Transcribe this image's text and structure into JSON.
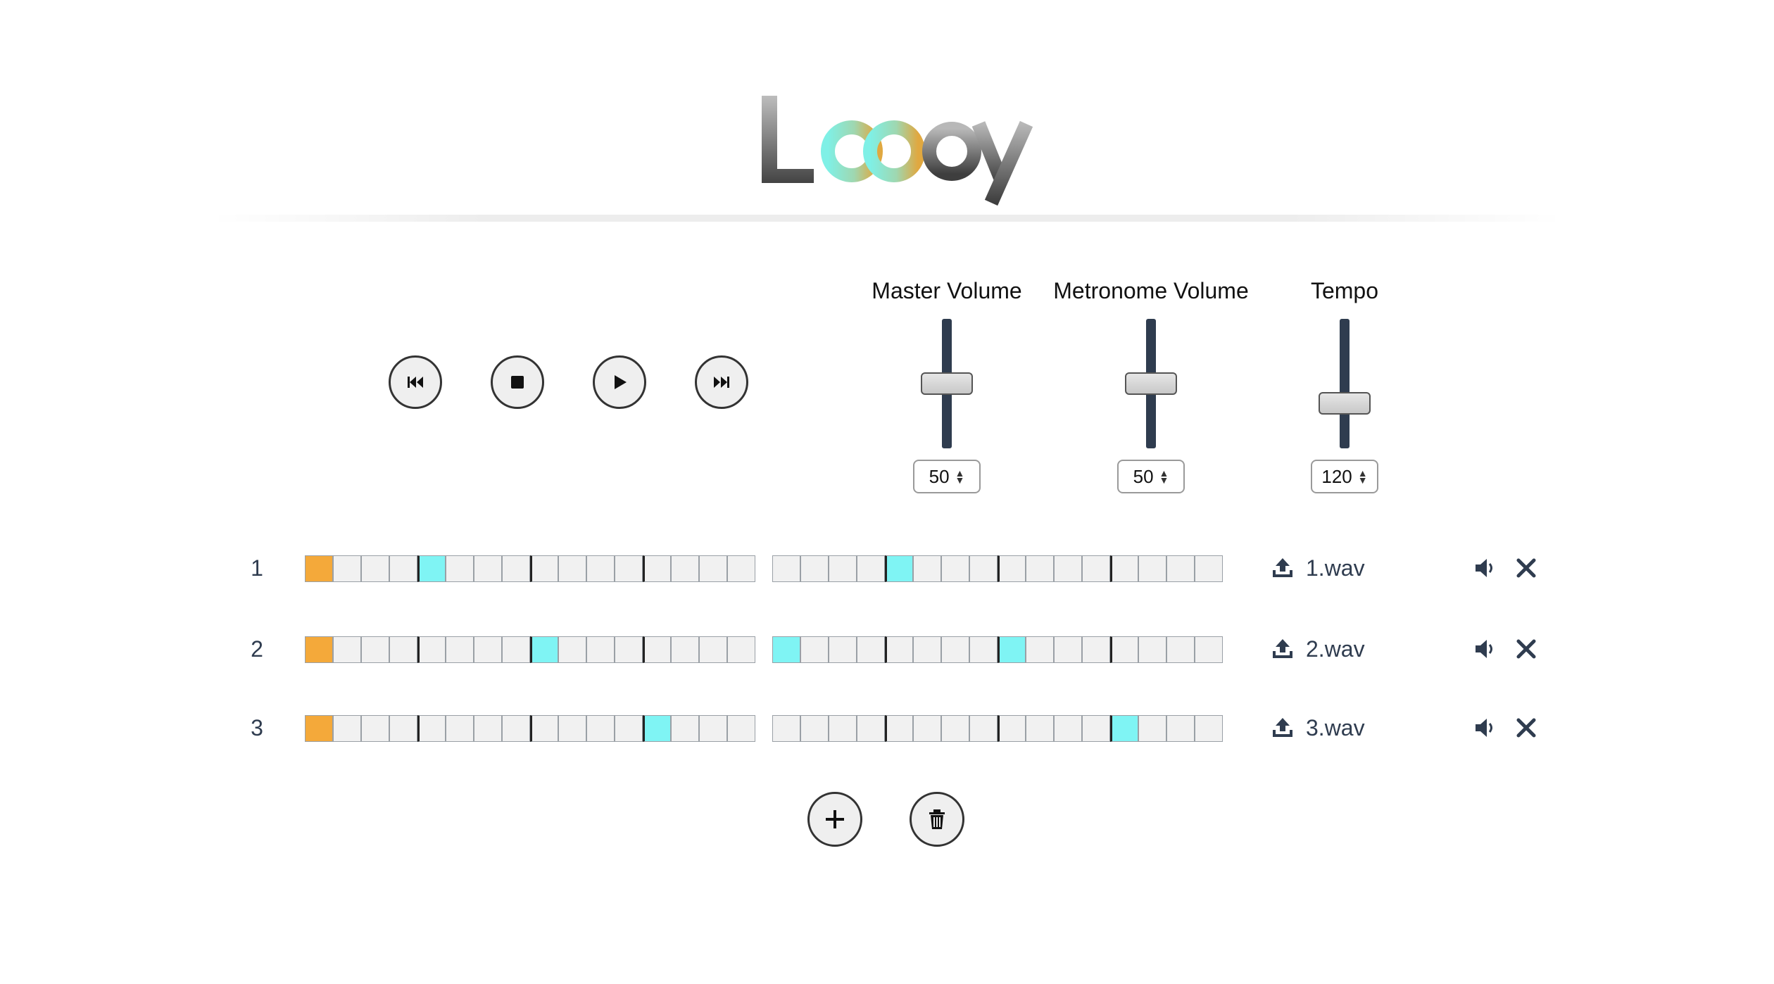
{
  "app": {
    "logo_text": "Loopy",
    "colors": {
      "track": "#2f3c4f",
      "current_step": "#f4a93a",
      "active_step": "#7ff4f4",
      "inactive_step": "#f1f1f1"
    }
  },
  "transport": {
    "buttons": [
      {
        "name": "skip-back",
        "icon": "skip-back-icon"
      },
      {
        "name": "stop",
        "icon": "stop-icon"
      },
      {
        "name": "play",
        "icon": "play-icon"
      },
      {
        "name": "skip-forward",
        "icon": "skip-forward-icon"
      }
    ]
  },
  "controls": {
    "master_volume": {
      "label": "Master Volume",
      "value": "50",
      "level": 0.5
    },
    "metronome_volume": {
      "label": "Metronome Volume",
      "value": "50",
      "level": 0.5
    },
    "tempo": {
      "label": "Tempo",
      "value": "120",
      "level": 0.35
    }
  },
  "tracks": [
    {
      "number": "1",
      "file": "1.wav",
      "current_step": 0,
      "active_steps": [
        4,
        20
      ]
    },
    {
      "number": "2",
      "file": "2.wav",
      "current_step": 0,
      "active_steps": [
        8,
        16,
        24
      ]
    },
    {
      "number": "3",
      "file": "3.wav",
      "current_step": 0,
      "active_steps": [
        12,
        28
      ]
    }
  ],
  "actions": {
    "add_icon": "plus-icon",
    "delete_icon": "trash-icon"
  }
}
